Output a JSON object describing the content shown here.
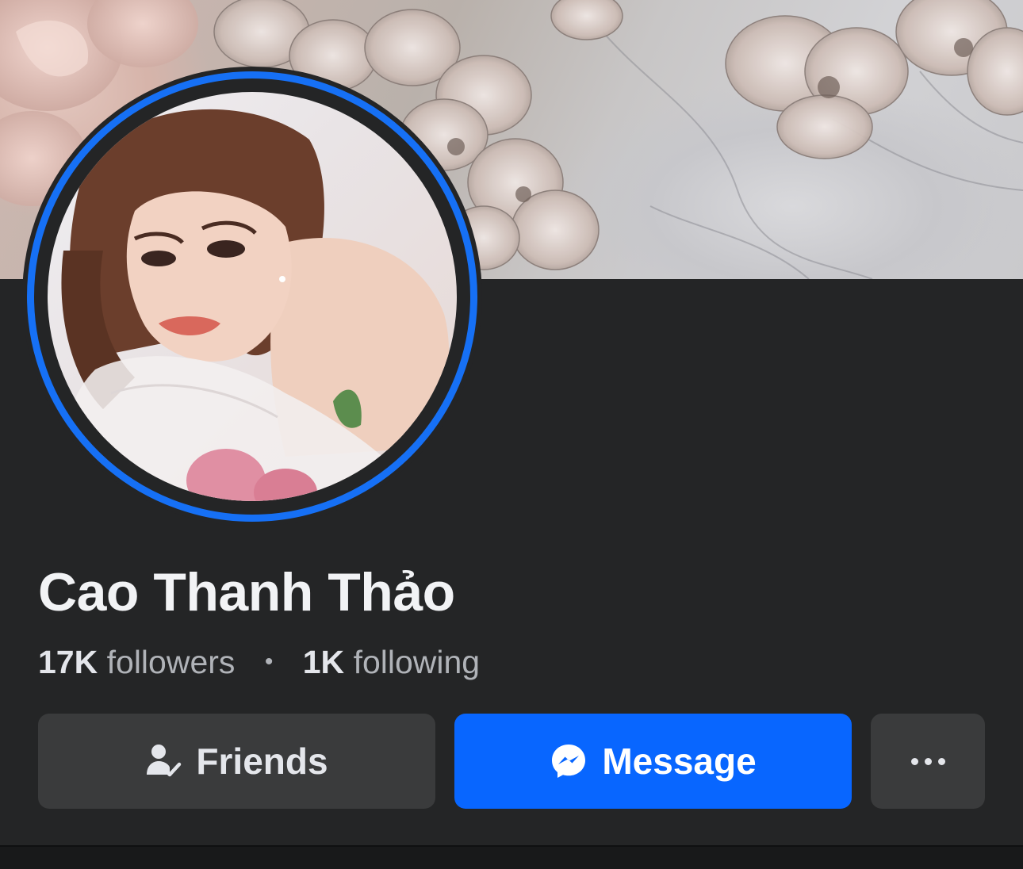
{
  "profile": {
    "name": "Cao Thanh Thảo",
    "followers_count": "17K",
    "followers_label": "followers",
    "separator": "•",
    "following_count": "1K",
    "following_label": "following"
  },
  "actions": {
    "friends_label": "Friends",
    "message_label": "Message",
    "more_label": "..."
  },
  "colors": {
    "background": "#242526",
    "avatar_ring": "#1670f5",
    "message_button": "#0866ff",
    "secondary_button": "#3a3b3c"
  },
  "icons": {
    "friends": "friends-check-icon",
    "message": "messenger-icon",
    "more": "more-dots-icon"
  }
}
